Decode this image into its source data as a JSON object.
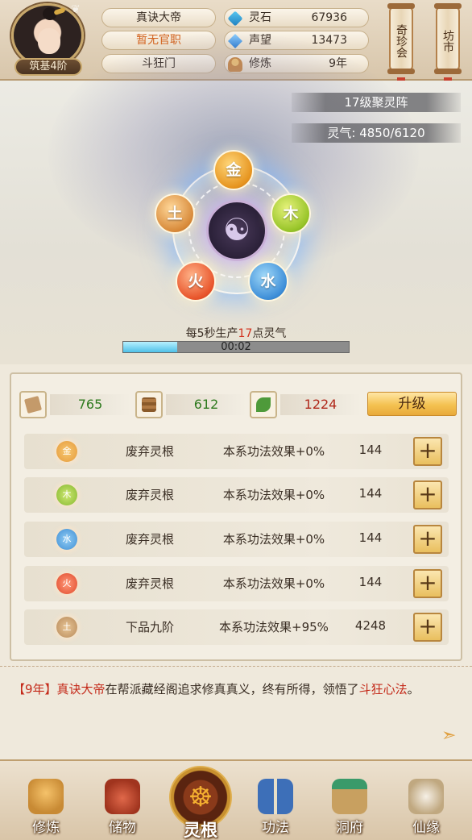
{
  "header": {
    "rank": "筑基4阶",
    "name": "真诀大帝",
    "office": "暂无官职",
    "sect": "斗狂门",
    "resources": [
      {
        "icon": "spirit-stone-icon",
        "label": "灵石",
        "value": "67936"
      },
      {
        "icon": "reputation-icon",
        "label": "声望",
        "value": "13473"
      },
      {
        "icon": "cultivation-icon",
        "label": "修炼",
        "value": "9年"
      }
    ],
    "shortcuts": [
      "奇珍会",
      "坊市"
    ]
  },
  "formation": {
    "level": "17级聚灵阵",
    "qi_label": "灵气:",
    "qi_value": "4850/6120",
    "elements": {
      "metal": "金",
      "wood": "木",
      "water": "水",
      "fire": "火",
      "earth": "土"
    },
    "produce_prefix": "每5秒生产",
    "produce_amount": "17",
    "produce_suffix": "点灵气",
    "progress_fraction": 0.24,
    "timer": "00:02"
  },
  "materials": [
    {
      "icon": "scroll-book-icon",
      "value": "765",
      "color": "green"
    },
    {
      "icon": "wood-log-icon",
      "value": "612",
      "color": "green"
    },
    {
      "icon": "herb-icon",
      "value": "1224",
      "color": "red"
    }
  ],
  "upgrade_label": "升级",
  "roots": [
    {
      "element": "金",
      "grade": "废弃灵根",
      "effect": "本系功法效果+0%",
      "cost": "144"
    },
    {
      "element": "木",
      "grade": "废弃灵根",
      "effect": "本系功法效果+0%",
      "cost": "144"
    },
    {
      "element": "水",
      "grade": "废弃灵根",
      "effect": "本系功法效果+0%",
      "cost": "144"
    },
    {
      "element": "火",
      "grade": "废弃灵根",
      "effect": "本系功法效果+0%",
      "cost": "144"
    },
    {
      "element": "土",
      "grade": "下品九阶",
      "effect": "本系功法效果+95%",
      "cost": "4248"
    }
  ],
  "plus_label": "+",
  "log": {
    "year": "【9年】",
    "actor": "真诀大帝",
    "text1": "在帮派藏经阁追求修真真义，终有所得，领悟了",
    "skill": "斗狂心法",
    "end": "。"
  },
  "nav": [
    {
      "icon": "cultivate-icon",
      "label": "修炼"
    },
    {
      "icon": "storage-bag-icon",
      "label": "储物"
    },
    {
      "icon": "spirit-root-icon",
      "label": "灵根"
    },
    {
      "icon": "technique-book-icon",
      "label": "功法"
    },
    {
      "icon": "cave-dwelling-icon",
      "label": "洞府"
    },
    {
      "icon": "immortal-fate-icon",
      "label": "仙缘"
    }
  ]
}
